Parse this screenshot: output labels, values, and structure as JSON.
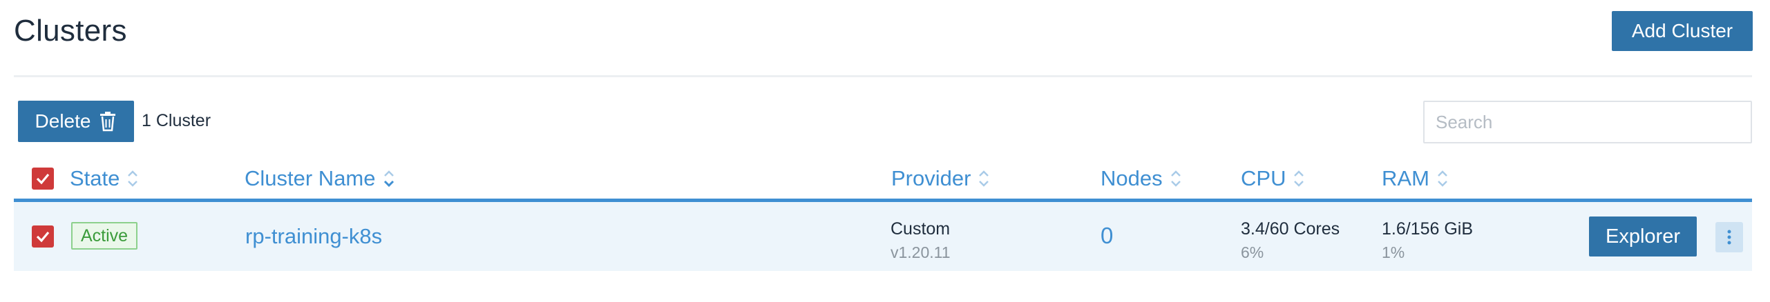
{
  "header": {
    "title": "Clusters",
    "add_button_label": "Add Cluster"
  },
  "toolbar": {
    "delete_label": "Delete",
    "count_label": "1 Cluster",
    "search_placeholder": "Search"
  },
  "table": {
    "columns": [
      {
        "key": "state",
        "label": "State"
      },
      {
        "key": "name",
        "label": "Cluster Name"
      },
      {
        "key": "provider",
        "label": "Provider"
      },
      {
        "key": "nodes",
        "label": "Nodes"
      },
      {
        "key": "cpu",
        "label": "CPU"
      },
      {
        "key": "ram",
        "label": "RAM"
      }
    ],
    "rows": [
      {
        "selected": true,
        "state": "Active",
        "name": "rp-training-k8s",
        "provider": "Custom",
        "provider_version": "v1.20.11",
        "nodes": "0",
        "cpu": "3.4/60 Cores",
        "cpu_pct": "6%",
        "ram": "1.6/156 GiB",
        "ram_pct": "1%",
        "action_label": "Explorer"
      }
    ]
  },
  "colors": {
    "primary": "#2f73a8",
    "link": "#3f8fd2",
    "checkbox": "#cf3a3a",
    "active_badge": "#3a9b3a",
    "row_bg": "#edf5fb"
  }
}
